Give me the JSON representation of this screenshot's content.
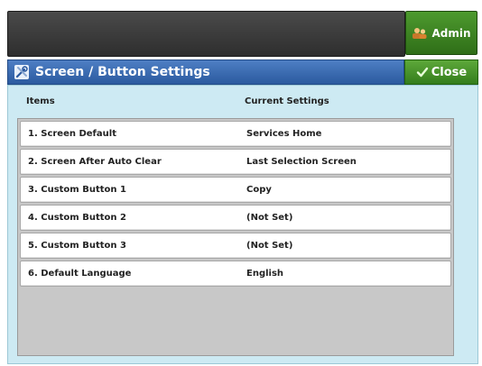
{
  "header": {
    "admin_label": "Admin"
  },
  "window": {
    "title": "Screen / Button Settings",
    "close_label": "Close"
  },
  "table": {
    "columns": [
      "Items",
      "Current Settings"
    ],
    "rows": [
      {
        "item": "1. Screen Default",
        "value": "Services Home"
      },
      {
        "item": "2. Screen After Auto Clear",
        "value": "Last Selection Screen"
      },
      {
        "item": "3. Custom Button 1",
        "value": "Copy"
      },
      {
        "item": "4. Custom Button 2",
        "value": "(Not Set)"
      },
      {
        "item": "5. Custom Button 3",
        "value": "(Not Set)"
      },
      {
        "item": "6. Default Language",
        "value": "English"
      }
    ]
  },
  "icons": {
    "admin": "admin-users-icon",
    "title": "tools-icon",
    "close": "check-icon"
  },
  "colors": {
    "title_bar": "#2b5a9f",
    "close_button": "#347d1c",
    "admin_button": "#2f6e18",
    "panel_bg": "#cdeaf3"
  }
}
